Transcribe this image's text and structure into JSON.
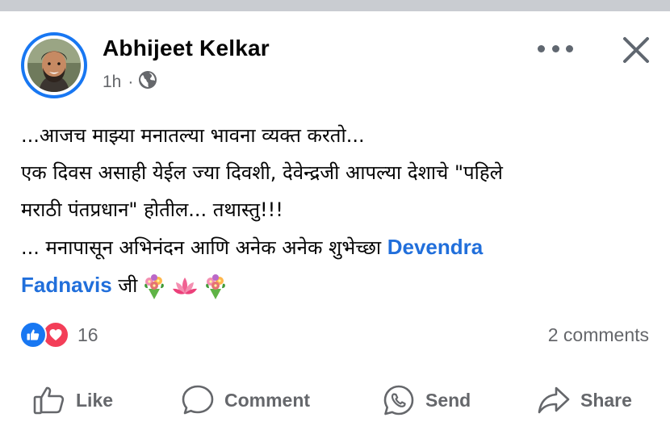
{
  "post": {
    "author": "Abhijeet Kelkar",
    "time": "1h",
    "separator": "·",
    "privacy_icon": "globe-icon",
    "lines": [
      "...आजच माझ्या मनातल्या भावना व्यक्त करतो...",
      "एक दिवस असाही येईल ज्या दिवशी,  देवेन्द्रजी आपल्या देशाचे \"पहिले",
      "मराठी पंतप्रधान\" होतील... तथास्तु!!!",
      "... मनापासून अभिनंदन आणि अनेक अनेक शुभेच्छा "
    ],
    "mention_part1": "Devendra",
    "mention_part2": "Fadnavis",
    "suffix": " जी",
    "emojis": [
      "bouquet",
      "lotus",
      "bouquet"
    ]
  },
  "reactions": {
    "icons": [
      "like-reaction-icon",
      "love-reaction-icon"
    ],
    "count": "16",
    "comments": "2 comments"
  },
  "actions": {
    "like": "Like",
    "comment": "Comment",
    "send": "Send",
    "share": "Share"
  },
  "colors": {
    "accent": "#1877f2",
    "mention": "#216fdb",
    "love": "#f33e58",
    "secondary_text": "#65676b",
    "primary_text": "#050505"
  }
}
